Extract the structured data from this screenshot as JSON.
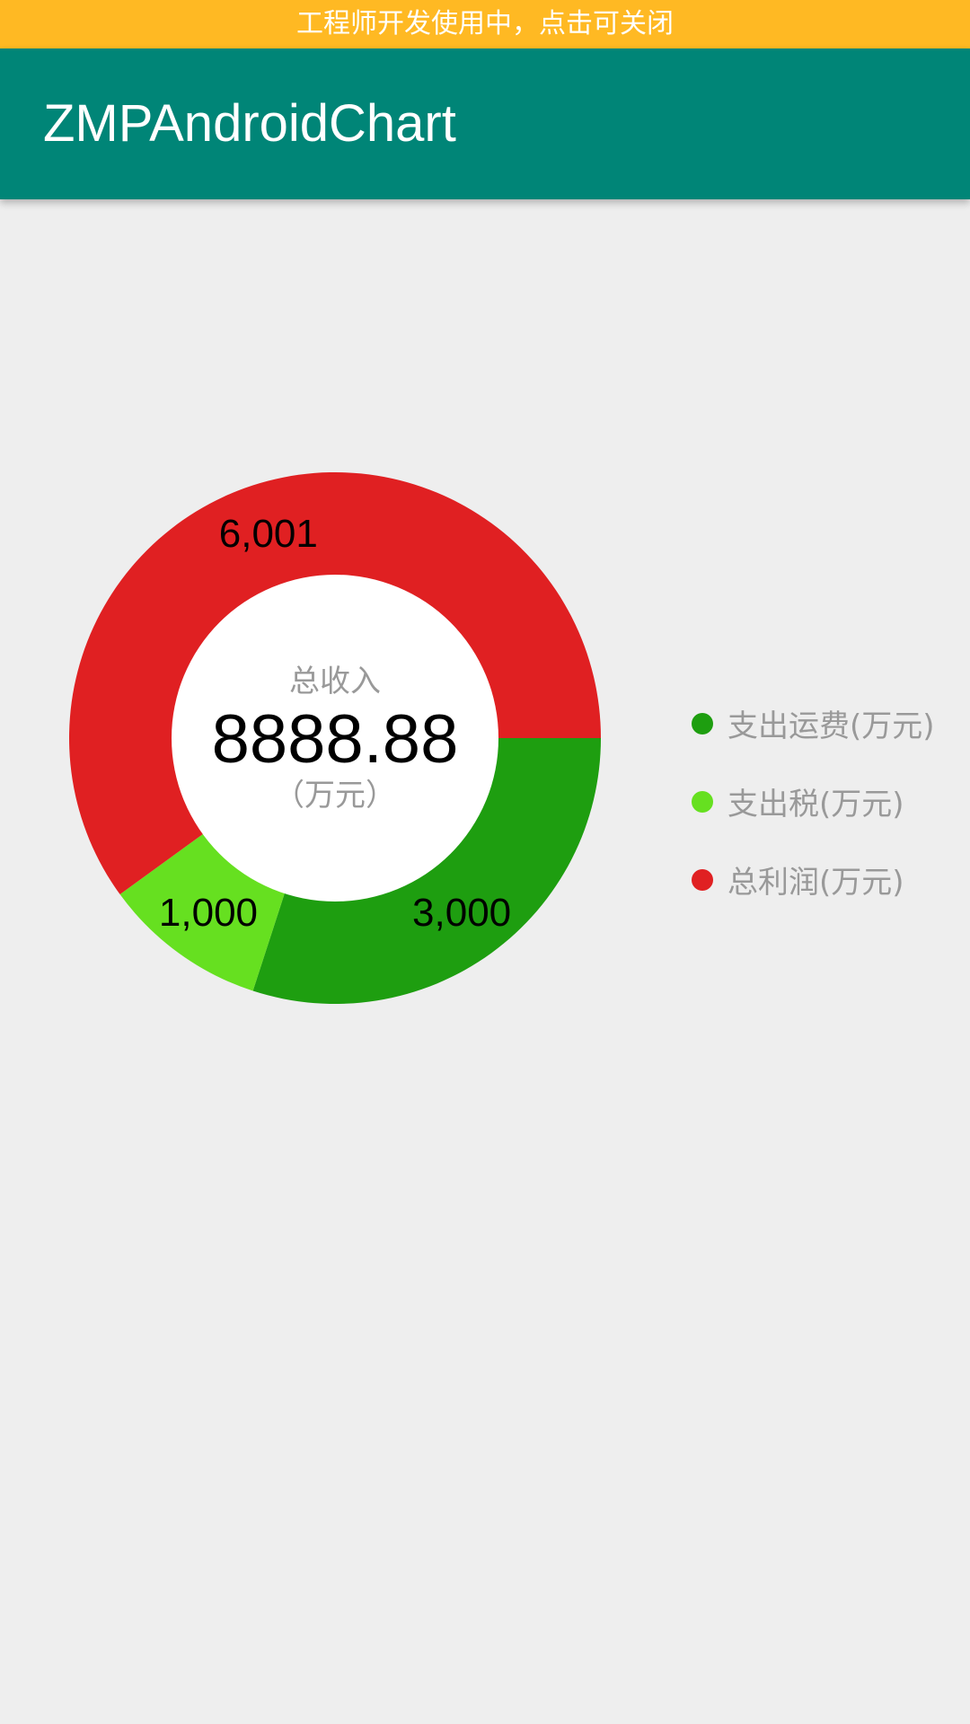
{
  "dev_banner": {
    "text": "工程师开发使用中，点击可关闭",
    "color": "#ffb923"
  },
  "app_bar": {
    "title": "ZMPAndroidChart",
    "color": "#008577"
  },
  "chart_data": {
    "type": "pie",
    "donut": true,
    "start_angle_deg": 0,
    "direction": "clockwise",
    "slices": [
      {
        "label": "支出运费(万元)",
        "value": 3000,
        "display": "3,000",
        "color": "#1e9e10"
      },
      {
        "label": "支出税(万元)",
        "value": 1000,
        "display": "1,000",
        "color": "#66e020"
      },
      {
        "label": "总利润(万元)",
        "value": 6001,
        "display": "6,001",
        "color": "#e02022"
      }
    ],
    "center": {
      "caption": "总收入",
      "value": "8888.88",
      "unit": "（万元）"
    },
    "legend_position": "right"
  }
}
